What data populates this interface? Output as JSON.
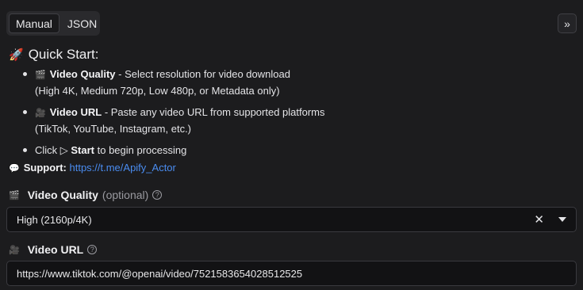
{
  "tabs": [
    {
      "label": "Manual",
      "active": true
    },
    {
      "label": "JSON",
      "active": false
    }
  ],
  "expand_icon": "»",
  "quick_start": {
    "title": "Quick Start:",
    "items": [
      {
        "strong": "Video Quality",
        "text": " - Select resolution for video download",
        "sub": "(High 4K, Medium 720p, Low 480p, or Metadata only)"
      },
      {
        "strong": "Video URL",
        "text": " - Paste any video URL from supported platforms",
        "sub": "(TikTok, YouTube, Instagram, etc.)"
      },
      {
        "prefix": "Click ▷ ",
        "strong": "Start",
        "text": " to begin processing"
      }
    ]
  },
  "support": {
    "label": "Support:",
    "link": "https://t.me/Apify_Actor"
  },
  "video_quality": {
    "label": "Video Quality",
    "optional": "(optional)",
    "value": "High (2160p/4K)"
  },
  "video_url": {
    "label": "Video URL",
    "value": "https://www.tiktok.com/@openai/video/7521583654028512525"
  },
  "icons": {
    "rocket": "rocket-icon",
    "clapper": "clapperboard-icon",
    "camera": "movie-camera-icon",
    "speech": "speech-bubble-icon",
    "help": "help-circle-icon",
    "clear": "close-icon",
    "caret": "chevron-down-icon"
  },
  "colors": {
    "background": "#1c1c1e",
    "link": "#4a8cf0",
    "input_bg": "#121214"
  }
}
